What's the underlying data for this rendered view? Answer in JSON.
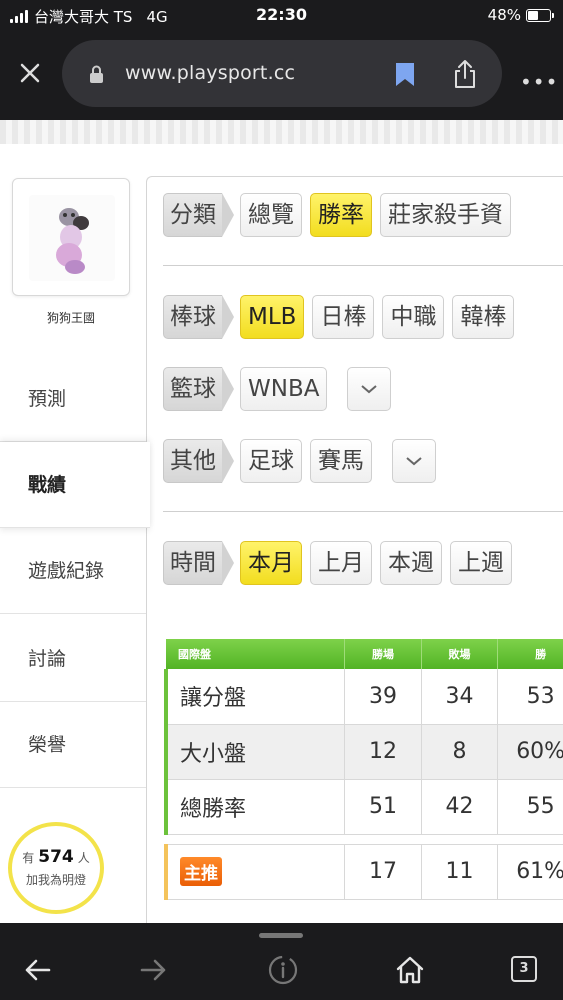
{
  "status_bar": {
    "carrier": "台灣大哥大 TS",
    "network": "4G",
    "time": "22:30",
    "battery": "48%",
    "battery_level": 0.48
  },
  "browser": {
    "url": "www.playsport.cc",
    "tab_count": "3",
    "icons": [
      "close-icon",
      "lock-icon",
      "bookmark-icon",
      "share-icon",
      "more-icon",
      "back-icon",
      "forward-icon",
      "info-icon",
      "home-icon",
      "tabs-icon"
    ],
    "bookmark_color": "#7ea6f0"
  },
  "sidebar": {
    "username": "狗狗王國",
    "items": [
      {
        "label": "預測"
      },
      {
        "label": "戰績",
        "active": true
      },
      {
        "label": "遊戲紀錄"
      },
      {
        "label": "討論"
      },
      {
        "label": "榮譽"
      }
    ],
    "fan_badge": {
      "prefix": "有",
      "count": "574",
      "suffix": "人",
      "action": "加我為明燈"
    }
  },
  "filters": {
    "category": {
      "label": "分類",
      "options": [
        "總覽",
        "勝率",
        "莊家殺手資"
      ],
      "selected": "勝率"
    },
    "baseball": {
      "label": "棒球",
      "options": [
        "MLB",
        "日棒",
        "中職",
        "韓棒"
      ],
      "selected": "MLB"
    },
    "basketball": {
      "label": "籃球",
      "options": [
        "WNBA"
      ]
    },
    "other": {
      "label": "其他",
      "options": [
        "足球",
        "賽馬"
      ]
    },
    "time": {
      "label": "時間",
      "options": [
        "本月",
        "上月",
        "本週",
        "上週"
      ],
      "selected": "本月"
    }
  },
  "stats_table": {
    "headers": [
      "國際盤",
      "勝場",
      "敗場",
      "勝"
    ],
    "rows": [
      {
        "name": "讓分盤",
        "wins": "39",
        "losses": "34",
        "rate": "53"
      },
      {
        "name": "大小盤",
        "wins": "12",
        "losses": "8",
        "rate": "60%"
      },
      {
        "name": "總勝率",
        "wins": "51",
        "losses": "42",
        "rate": "55"
      }
    ],
    "featured": {
      "tag": "主推",
      "wins": "17",
      "losses": "11",
      "rate": "61%"
    }
  },
  "colors": {
    "selected_chip": "#f5e231",
    "table_header": "#5cb82c",
    "featured_tag": "#f07212",
    "badge_ring": "#f3e34a",
    "browser_chrome": "#1b1b1d"
  }
}
